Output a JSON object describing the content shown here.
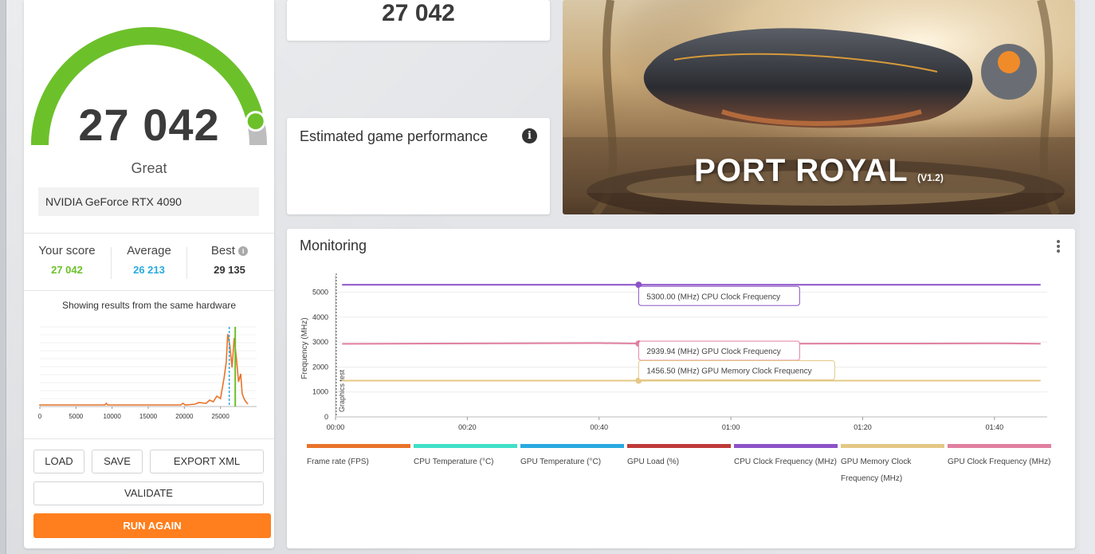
{
  "score": {
    "value": "27 042",
    "rating": "Great",
    "gpu": "NVIDIA GeForce RTX 4090",
    "gauge_fraction": 0.93,
    "colors": {
      "gauge_fill": "#6cc12a",
      "gauge_track": "#bdbdbd"
    }
  },
  "stats": {
    "your_score_label": "Your score",
    "your_score_value": "27 042",
    "average_label": "Average",
    "average_value": "26 213",
    "best_label": "Best",
    "best_value": "29 135",
    "info_icon": "i",
    "colors": {
      "your": "#6cc12a",
      "average": "#29a9e0",
      "best": "#333333"
    }
  },
  "histogram": {
    "caption": "Showing results from the same hardware",
    "x_ticks": [
      "0",
      "5000",
      "10000",
      "15000",
      "20000",
      "25000"
    ],
    "x_range": [
      0,
      30000
    ],
    "your_score": 27042,
    "average": 26213
  },
  "actions": {
    "load": "LOAD",
    "save": "SAVE",
    "export": "EXPORT XML",
    "validate": "VALIDATE",
    "run_again": "RUN AGAIN"
  },
  "top_score": "27 042",
  "estimated": {
    "title": "Estimated game performance",
    "info_icon": "i"
  },
  "hero": {
    "title": "PORT ROYAL",
    "version": "(V1.2)"
  },
  "monitoring": {
    "title": "Monitoring",
    "marker_label": "Graphics test",
    "tooltips": [
      "5300.00 (MHz) CPU Clock Frequency",
      "2939.94 (MHz) GPU Clock Frequency",
      "1456.50 (MHz) GPU Memory Clock Frequency"
    ],
    "legend": [
      {
        "label": "Frame rate (FPS)",
        "color": "#e8732a"
      },
      {
        "label": "CPU Temperature (°C)",
        "color": "#3fe0c8"
      },
      {
        "label": "GPU Temperature (°C)",
        "color": "#29a9e0"
      },
      {
        "label": "GPU Load (%)",
        "color": "#c03a3a"
      },
      {
        "label": "CPU Clock Frequency (MHz)",
        "color": "#8c52c7"
      },
      {
        "label": "GPU Memory Clock Frequency (MHz)",
        "color": "#e4c886"
      },
      {
        "label": "GPU Clock Frequency (MHz)",
        "color": "#e17fa0"
      }
    ]
  },
  "chart_data": {
    "type": "line",
    "ylabel": "Frequency (MHz)",
    "y_ticks": [
      "0",
      "1000",
      "2000",
      "3000",
      "4000",
      "5000"
    ],
    "ylim": [
      0,
      5500
    ],
    "x_ticks": [
      "00:00",
      "00:20",
      "00:40",
      "01:00",
      "01:20",
      "01:40"
    ],
    "xlim": [
      0,
      108
    ],
    "series": [
      {
        "name": "CPU Clock Frequency (MHz)",
        "color": "#8c52c7",
        "x": [
          1,
          46,
          107
        ],
        "values": [
          5300,
          5300,
          5300
        ]
      },
      {
        "name": "GPU Clock Frequency (MHz)",
        "color": "#e17fa0",
        "x": [
          1,
          20,
          40,
          46,
          60,
          80,
          100,
          107
        ],
        "values": [
          2930,
          2945,
          2960,
          2940,
          2935,
          2940,
          2950,
          2935
        ]
      },
      {
        "name": "GPU Memory Clock Frequency (MHz)",
        "color": "#e4c886",
        "x": [
          1,
          46,
          107
        ],
        "values": [
          1456.5,
          1456.5,
          1456.5
        ]
      }
    ],
    "highlight_x": 46
  }
}
